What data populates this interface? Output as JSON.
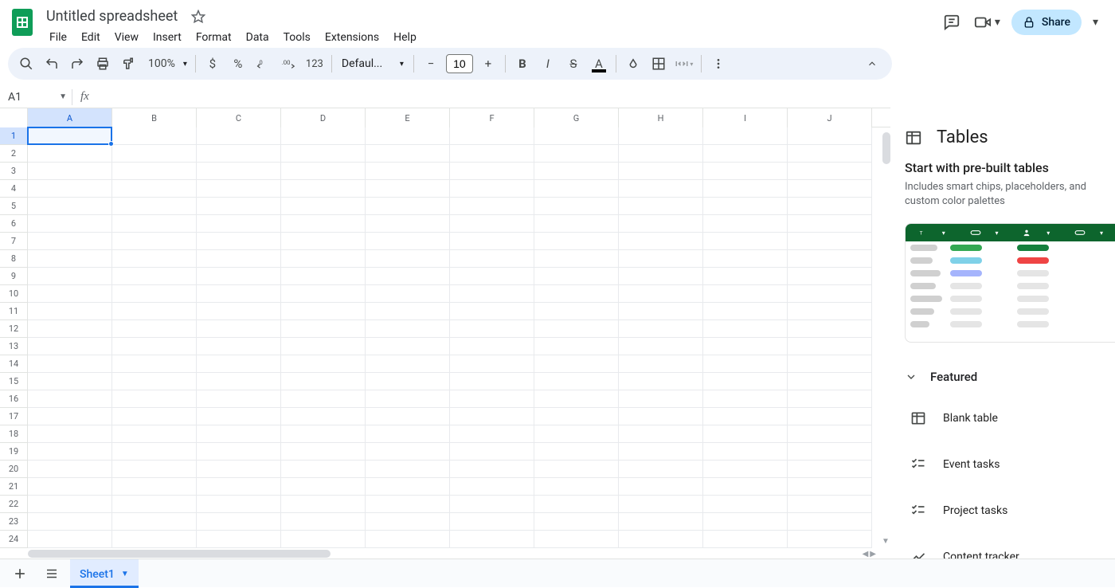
{
  "header": {
    "title": "Untitled spreadsheet",
    "menu": [
      "File",
      "Edit",
      "View",
      "Insert",
      "Format",
      "Data",
      "Tools",
      "Extensions",
      "Help"
    ],
    "share_label": "Share"
  },
  "toolbar": {
    "zoom": "100%",
    "currency": "$",
    "percent": "%",
    "num_fmt": "123",
    "font": "Defaul...",
    "font_size": "10"
  },
  "name_box": "A1",
  "formula": "",
  "columns": [
    "A",
    "B",
    "C",
    "D",
    "E",
    "F",
    "G",
    "H",
    "I",
    "J"
  ],
  "rows": [
    1,
    2,
    3,
    4,
    5,
    6,
    7,
    8,
    9,
    10,
    11,
    12,
    13,
    14,
    15,
    16,
    17,
    18,
    19,
    20,
    21,
    22,
    23,
    24
  ],
  "selected_cell": "A1",
  "side_panel": {
    "title": "Tables",
    "intro_title": "Start with pre-built tables",
    "intro_text": "Includes smart chips, placeholders, and custom color palettes",
    "section": "Featured",
    "items": [
      "Blank table",
      "Event tasks",
      "Project tasks",
      "Content tracker"
    ]
  },
  "sheetbar": {
    "tabs": [
      "Sheet1"
    ],
    "active": 0
  }
}
